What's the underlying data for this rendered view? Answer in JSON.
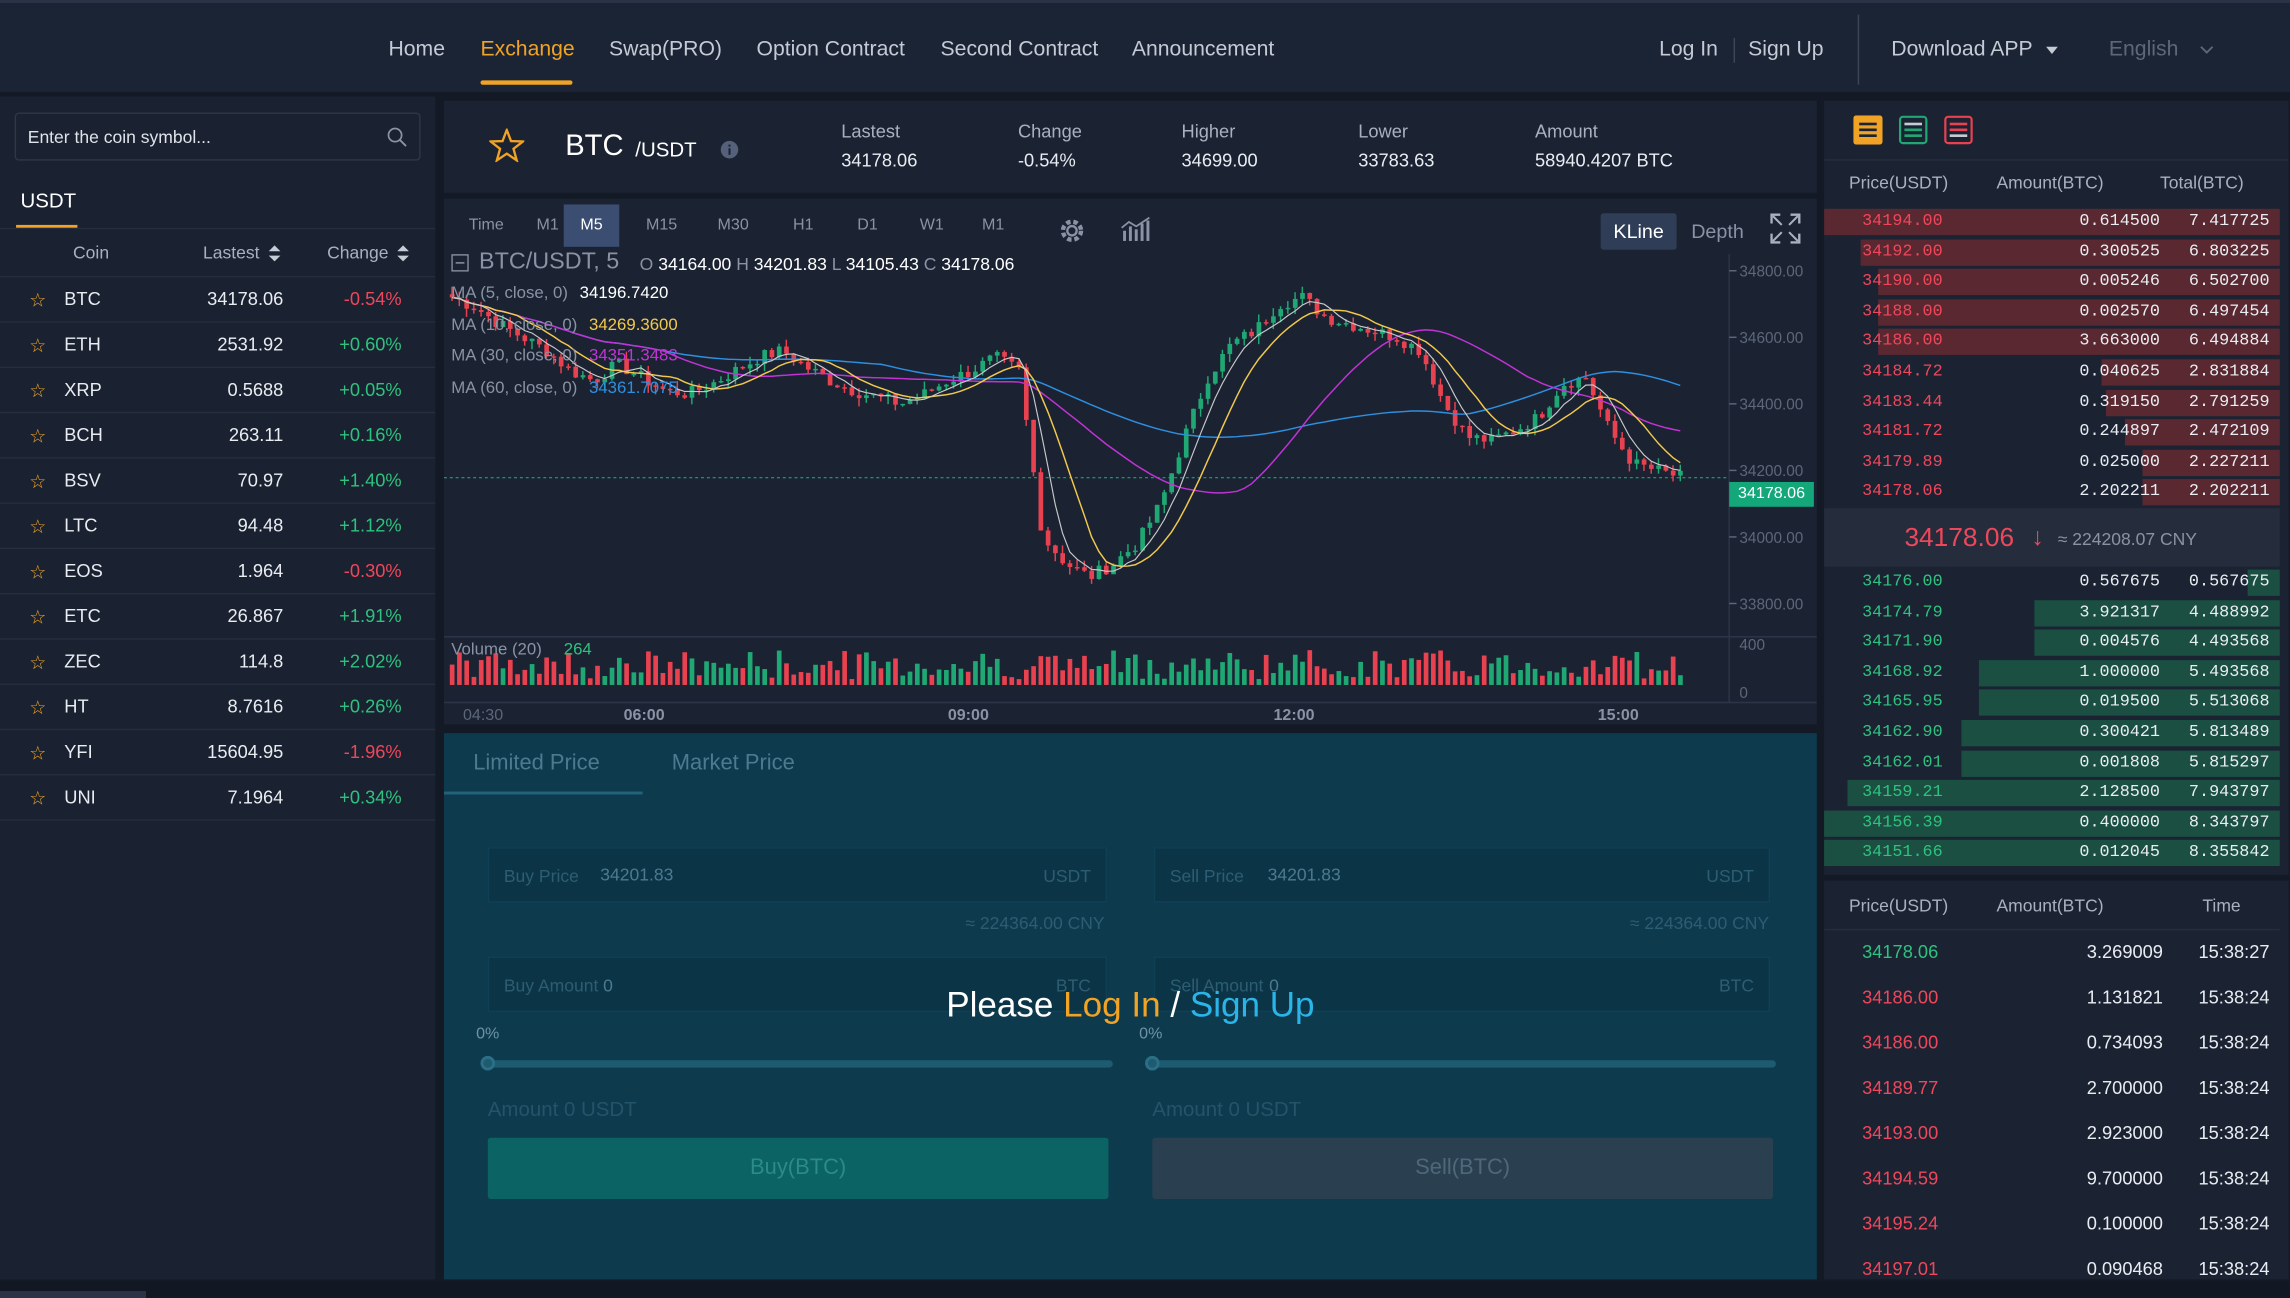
{
  "nav": {
    "links": [
      "Home",
      "Exchange",
      "Swap(PRO)",
      "Option Contract",
      "Second Contract",
      "Announcement"
    ],
    "active_index": 1,
    "login": "Log In",
    "signup": "Sign Up",
    "download": "Download APP",
    "language": "English",
    "accent_color": "#f0a324"
  },
  "market": {
    "search_placeholder": "Enter the coin symbol...",
    "quote_tab": "USDT",
    "columns": [
      "Coin",
      "Lastest",
      "Change"
    ],
    "coins": [
      {
        "symbol": "BTC",
        "price": "34178.06",
        "change": "-0.54%"
      },
      {
        "symbol": "ETH",
        "price": "2531.92",
        "change": "+0.60%"
      },
      {
        "symbol": "XRP",
        "price": "0.5688",
        "change": "+0.05%"
      },
      {
        "symbol": "BCH",
        "price": "263.11",
        "change": "+0.16%"
      },
      {
        "symbol": "BSV",
        "price": "70.97",
        "change": "+1.40%"
      },
      {
        "symbol": "LTC",
        "price": "94.48",
        "change": "+1.12%"
      },
      {
        "symbol": "EOS",
        "price": "1.964",
        "change": "-0.30%"
      },
      {
        "symbol": "ETC",
        "price": "26.867",
        "change": "+1.91%"
      },
      {
        "symbol": "ZEC",
        "price": "114.8",
        "change": "+2.02%"
      },
      {
        "symbol": "HT",
        "price": "8.7616",
        "change": "+0.26%"
      },
      {
        "symbol": "YFI",
        "price": "15604.95",
        "change": "-1.96%"
      },
      {
        "symbol": "UNI",
        "price": "7.1964",
        "change": "+0.34%"
      }
    ]
  },
  "ticker": {
    "base": "BTC",
    "quote": "/USDT",
    "lastest_label": "Lastest",
    "lastest": "34178.06",
    "change_label": "Change",
    "change": "-0.54%",
    "higher_label": "Higher",
    "higher": "34699.00",
    "lower_label": "Lower",
    "lower": "33783.63",
    "amount_label": "Amount",
    "amount": "58940.4207 BTC"
  },
  "chart_toolbar": {
    "timeframes": [
      "Time",
      "M1",
      "M5",
      "M15",
      "M30",
      "H1",
      "D1",
      "W1",
      "M1"
    ],
    "active_index": 2,
    "kline": "KLine",
    "depth": "Depth"
  },
  "chart_data": {
    "type": "candlestick",
    "symbol_label": "BTC/USDT, 5",
    "ohlc_legend": {
      "o_label": "O",
      "o": "34164.00",
      "h_label": "H",
      "h": "34201.83",
      "l_label": "L",
      "l": "34105.43",
      "c_label": "C",
      "c": "34178.06"
    },
    "ma_legends": [
      {
        "label": "MA (5, close, 0)",
        "value": "34196.7420",
        "color": "#ffffff"
      },
      {
        "label": "MA (10, close, 0)",
        "value": "34269.3600",
        "color": "#f2c94c"
      },
      {
        "label": "MA (30, close, 0)",
        "value": "34351.3483",
        "color": "#c233d6"
      },
      {
        "label": "MA (60, close, 0)",
        "value": "34361.7075",
        "color": "#2d8fe0"
      }
    ],
    "volume_label": "Volume (20)",
    "volume_value": "264",
    "y_ticks": [
      "34800.00",
      "34600.00",
      "34400.00",
      "34200.00",
      "34000.00",
      "33800.00"
    ],
    "volume_ticks": [
      "400",
      "0"
    ],
    "x_ticks": [
      "04:30",
      "06:00",
      "09:00",
      "12:00",
      "15:00"
    ],
    "last_price_tag": "34178.06",
    "close_path": [
      34720,
      34690,
      34640,
      34600,
      34560,
      34500,
      34470,
      34520,
      34480,
      34440,
      34430,
      34460,
      34500,
      34540,
      34560,
      34510,
      34470,
      34440,
      34420,
      34400,
      34430,
      34470,
      34500,
      34540,
      34500,
      34000,
      33920,
      33880,
      33920,
      33980,
      34100,
      34300,
      34480,
      34580,
      34620,
      34700,
      34720,
      34660,
      34640,
      34620,
      34600,
      34560,
      34400,
      34300,
      34290,
      34320,
      34360,
      34460,
      34480,
      34320,
      34220,
      34200,
      34180
    ],
    "up_color": "#20a874",
    "down_color": "#e8414f"
  },
  "trade": {
    "tab_limit": "Limited Price",
    "tab_market": "Market Price",
    "buy_price_label": "Buy Price",
    "buy_price": "34201.83",
    "buy_price_unit": "USDT",
    "buy_cny": "≈ 224364.00 CNY",
    "sell_price_label": "Sell Price",
    "sell_price": "34201.83",
    "sell_price_unit": "USDT",
    "sell_cny": "≈ 224364.00 CNY",
    "buy_amount_label": "Buy Amount",
    "buy_amount": "0",
    "buy_amount_unit": "BTC",
    "sell_amount_label": "Sell Amount",
    "sell_amount": "0",
    "sell_amount_unit": "BTC",
    "buy_pct": "0%",
    "sell_pct": "0%",
    "buy_total": "Amount 0 USDT",
    "sell_total": "Amount 0 USDT",
    "buy_button": "Buy(BTC)",
    "sell_button": "Sell(BTC)",
    "prompt_please": "Please",
    "prompt_login": "Log In",
    "prompt_slash": "/",
    "prompt_signup": "Sign Up"
  },
  "orderbook": {
    "headers": [
      "Price(USDT)",
      "Amount(BTC)",
      "Total(BTC)"
    ],
    "asks": [
      {
        "price": "34194.00",
        "amount": "0.614500",
        "total": "7.417725",
        "depth": 1.0
      },
      {
        "price": "34192.00",
        "amount": "0.300525",
        "total": "6.803225",
        "depth": 0.92
      },
      {
        "price": "34190.00",
        "amount": "0.005246",
        "total": "6.502700",
        "depth": 0.88
      },
      {
        "price": "34188.00",
        "amount": "0.002570",
        "total": "6.497454",
        "depth": 0.88
      },
      {
        "price": "34186.00",
        "amount": "3.663000",
        "total": "6.494884",
        "depth": 0.88
      },
      {
        "price": "34184.72",
        "amount": "0.040625",
        "total": "2.831884",
        "depth": 0.39
      },
      {
        "price": "34183.44",
        "amount": "0.319150",
        "total": "2.791259",
        "depth": 0.38
      },
      {
        "price": "34181.72",
        "amount": "0.244897",
        "total": "2.472109",
        "depth": 0.34
      },
      {
        "price": "34179.89",
        "amount": "0.025000",
        "total": "2.227211",
        "depth": 0.3
      },
      {
        "price": "34178.06",
        "amount": "2.202211",
        "total": "2.202211",
        "depth": 0.3
      }
    ],
    "mid_price": "34178.06",
    "mid_arrow": "↓",
    "mid_cny": "≈ 224208.07 CNY",
    "bids": [
      {
        "price": "34176.00",
        "amount": "0.567675",
        "total": "0.567675",
        "depth": 0.07
      },
      {
        "price": "34174.79",
        "amount": "3.921317",
        "total": "4.488992",
        "depth": 0.54
      },
      {
        "price": "34171.90",
        "amount": "0.004576",
        "total": "4.493568",
        "depth": 0.54
      },
      {
        "price": "34168.92",
        "amount": "1.000000",
        "total": "5.493568",
        "depth": 0.66
      },
      {
        "price": "34165.95",
        "amount": "0.019500",
        "total": "5.513068",
        "depth": 0.66
      },
      {
        "price": "34162.90",
        "amount": "0.300421",
        "total": "5.813489",
        "depth": 0.7
      },
      {
        "price": "34162.01",
        "amount": "0.001808",
        "total": "5.815297",
        "depth": 0.7
      },
      {
        "price": "34159.21",
        "amount": "2.128500",
        "total": "7.943797",
        "depth": 0.95
      },
      {
        "price": "34156.39",
        "amount": "0.400000",
        "total": "8.343797",
        "depth": 1.0
      },
      {
        "price": "34151.66",
        "amount": "0.012045",
        "total": "8.355842",
        "depth": 1.0
      }
    ]
  },
  "recent_trades": {
    "headers": [
      "Price(USDT)",
      "Amount(BTC)",
      "Time"
    ],
    "rows": [
      {
        "price": "34178.06",
        "amount": "3.269009",
        "time": "15:38:27",
        "side": "buy"
      },
      {
        "price": "34186.00",
        "amount": "1.131821",
        "time": "15:38:24",
        "side": "sell"
      },
      {
        "price": "34186.00",
        "amount": "0.734093",
        "time": "15:38:24",
        "side": "sell"
      },
      {
        "price": "34189.77",
        "amount": "2.700000",
        "time": "15:38:24",
        "side": "sell"
      },
      {
        "price": "34193.00",
        "amount": "2.923000",
        "time": "15:38:24",
        "side": "sell"
      },
      {
        "price": "34194.59",
        "amount": "9.700000",
        "time": "15:38:24",
        "side": "sell"
      },
      {
        "price": "34195.24",
        "amount": "0.100000",
        "time": "15:38:24",
        "side": "sell"
      },
      {
        "price": "34197.01",
        "amount": "0.090468",
        "time": "15:38:24",
        "side": "sell"
      }
    ]
  }
}
